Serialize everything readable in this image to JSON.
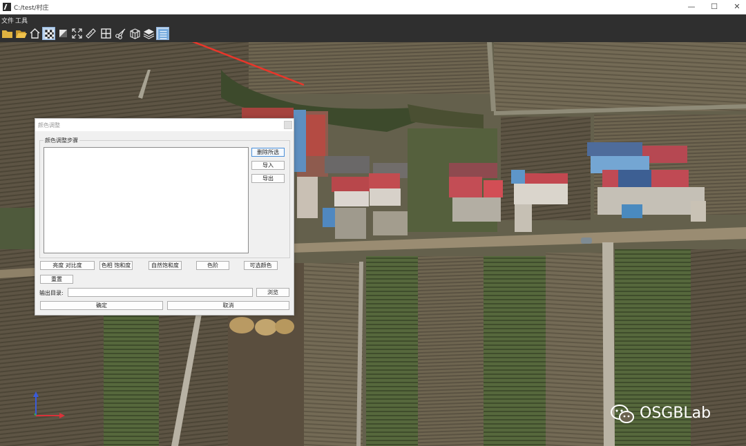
{
  "window": {
    "title": "C:/test/村庄",
    "minimize_glyph": "—",
    "maximize_glyph": "☐",
    "close_glyph": "✕"
  },
  "menu": {
    "items": [
      {
        "label": "文件"
      },
      {
        "label": "工具"
      }
    ]
  },
  "toolbar": {
    "tools": [
      {
        "icon": "folder-icon"
      },
      {
        "icon": "folder-open-icon"
      },
      {
        "icon": "home-icon"
      },
      {
        "icon": "checkerboard-icon"
      },
      {
        "icon": "diagonal-square-icon"
      },
      {
        "icon": "expand-icon"
      },
      {
        "icon": "ruler-icon"
      },
      {
        "icon": "grid-icon"
      },
      {
        "icon": "scissors-icon"
      },
      {
        "icon": "cube-grid-icon"
      },
      {
        "icon": "layers-icon"
      },
      {
        "icon": "color-adjust-icon",
        "active": true
      }
    ]
  },
  "dialog": {
    "title": "颜色调整",
    "group_label": "颜色调整步骤",
    "delete_selected": "删除所选",
    "import": "导入",
    "export": "导出",
    "adjust_buttons": [
      {
        "label": "亮度 对比度"
      },
      {
        "label": "色相 饱和度"
      },
      {
        "label": "自然饱和度"
      },
      {
        "label": "色阶"
      },
      {
        "label": "可选颜色"
      }
    ],
    "reset": "重置",
    "output_dir_label": "输出目录:",
    "output_dir_value": "",
    "browse": "浏览",
    "ok": "确定",
    "cancel": "取消"
  },
  "watermark": {
    "text": "OSGBLab"
  },
  "colors": {
    "toolbar_bg": "#2f2f2f",
    "dialog_bg": "#f0f0f0",
    "annotation_arrow": "#e8362a",
    "active_tool": "#bcd4ee"
  }
}
